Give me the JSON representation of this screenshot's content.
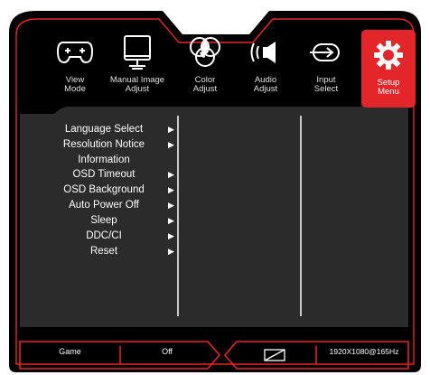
{
  "tabs": [
    {
      "line1": "View",
      "line2": "Mode",
      "icon": "gamepad-icon"
    },
    {
      "line1": "Manual Image",
      "line2": "Adjust",
      "icon": "monitor-icon"
    },
    {
      "line1": "Color",
      "line2": "Adjust",
      "icon": "color-circles-icon"
    },
    {
      "line1": "Audio",
      "line2": "Adjust",
      "icon": "speaker-icon"
    },
    {
      "line1": "Input",
      "line2": "Select",
      "icon": "input-icon"
    },
    {
      "line1": "Setup",
      "line2": "Menu",
      "icon": "gear-icon"
    }
  ],
  "active_tab": "Setup Menu",
  "menu_items": [
    {
      "label": "Language Select",
      "arrow": "▶"
    },
    {
      "label": "Resolution Notice",
      "arrow": "▶"
    },
    {
      "label": "Information",
      "arrow": ""
    },
    {
      "label": "OSD Timeout",
      "arrow": "▶"
    },
    {
      "label": "OSD Background",
      "arrow": "▶"
    },
    {
      "label": "Auto Power Off",
      "arrow": "▶"
    },
    {
      "label": "Sleep",
      "arrow": "▶"
    },
    {
      "label": "DDC/CI",
      "arrow": "▶"
    },
    {
      "label": "Reset",
      "arrow": "▶"
    }
  ],
  "status": {
    "mode": "Game",
    "value": "Off",
    "resolution": "1920X1080@165Hz",
    "aspect_icon": "aspect-ratio-icon"
  },
  "colors": {
    "accent": "#e2262a",
    "frame": "#000000",
    "panel": "#2b2b2b",
    "text": "#ffffff"
  }
}
